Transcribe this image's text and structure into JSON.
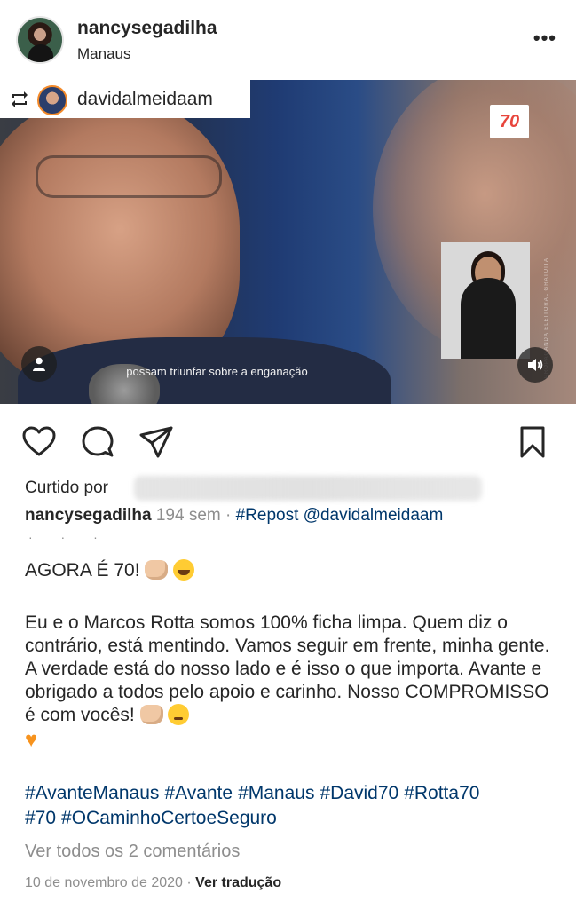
{
  "post": {
    "username": "nancysegadilha",
    "location": "Manaus",
    "more_label": "•••"
  },
  "repost": {
    "username": "davidalmeidaam"
  },
  "media": {
    "logo_text": "70",
    "subtitle": "possam triunfar sobre a enganação",
    "vertical_text": "PROPAGANDA ELEITORAL GRATUITA"
  },
  "likes": {
    "prefix": "Curtido por"
  },
  "caption": {
    "username": "nancysegadilha",
    "time": "194 sem",
    "separator": "·",
    "tag_text": "#Repost @davidalmeidaam",
    "more_dots": "· · ·",
    "headline": "AGORA É 70!",
    "paragraph": "Eu e o Marcos Rotta somos 100% ficha limpa. Quem diz o contrário, está mentindo. Vamos seguir em frente, minha gente. A verdade está do nosso lado e é isso o que importa. Avante e obrigado a todos pelo apoio e carinho. Nosso COMPROMISSO é com vocês!"
  },
  "hashtags": [
    "#AvanteManaus",
    "#Avante",
    "#Manaus",
    "#David70",
    "#Rotta70",
    "#70",
    "#OCaminhoCertoeSeguro"
  ],
  "view_comments": "Ver todos os 2 comentários",
  "date": "10 de novembro de 2020",
  "date_separator": "·",
  "translate": "Ver tradução",
  "colors": {
    "link": "#00376b",
    "muted": "#8e8e8e",
    "text": "#262626",
    "logo_red": "#e8453c"
  },
  "icons": [
    "repost-icon",
    "heart-icon",
    "comment-icon",
    "share-icon",
    "bookmark-icon",
    "user-icon",
    "sound-icon",
    "more-icon"
  ]
}
